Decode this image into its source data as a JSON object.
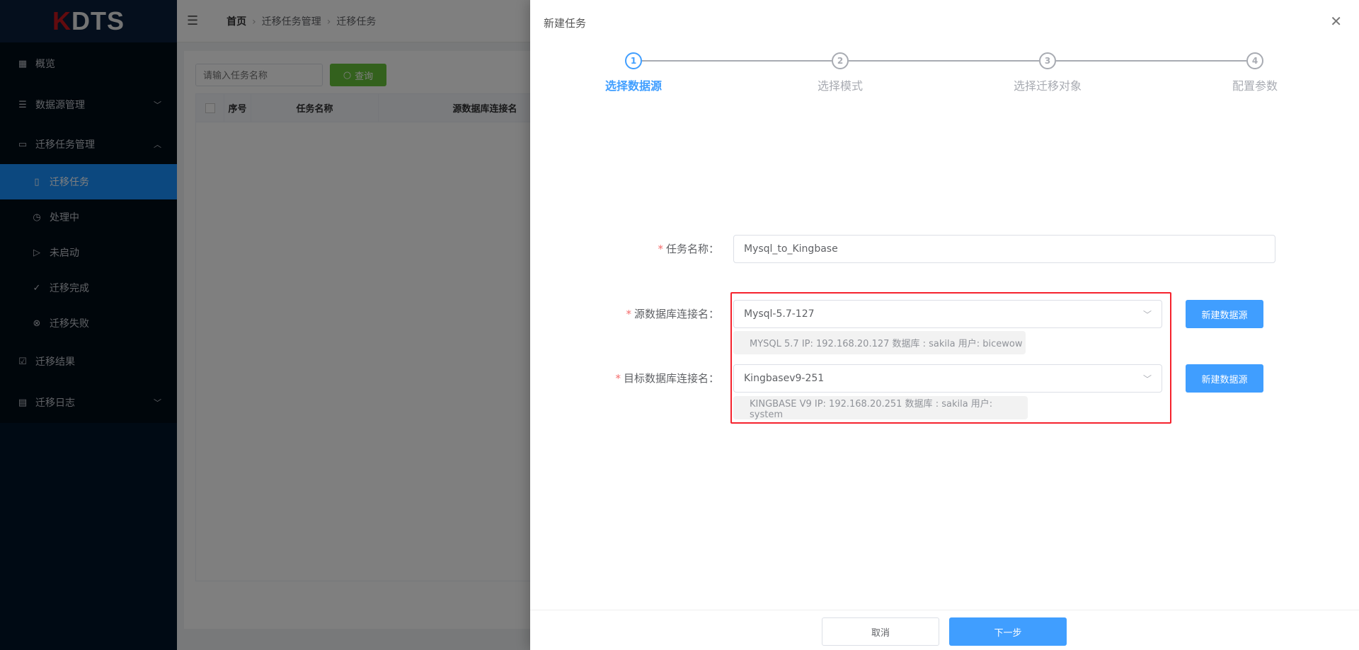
{
  "sidebar": {
    "logo": "KDTS",
    "items": [
      {
        "label": "概览",
        "icon": "grid-icon"
      },
      {
        "label": "数据源管理",
        "icon": "database-icon"
      },
      {
        "label": "迁移任务管理",
        "icon": "folder-icon"
      },
      {
        "label": "迁移任务",
        "icon": "book-icon",
        "active": true
      },
      {
        "label": "处理中",
        "icon": "stopwatch-icon"
      },
      {
        "label": "未启动",
        "icon": "play-circle-icon"
      },
      {
        "label": "迁移完成",
        "icon": "check-list-icon"
      },
      {
        "label": "迁移失败",
        "icon": "close-circle-icon"
      },
      {
        "label": "迁移结果",
        "icon": "folder-check-icon"
      },
      {
        "label": "迁移日志",
        "icon": "document-icon"
      }
    ]
  },
  "breadcrumb": [
    "首页",
    "迁移任务管理",
    "迁移任务"
  ],
  "search": {
    "placeholder": "请输入任务名称",
    "button": "查询"
  },
  "table": {
    "columns": [
      "序号",
      "任务名称",
      "源数据库连接名"
    ]
  },
  "drawer": {
    "title": "新建任务",
    "steps": [
      "选择数据源",
      "选择模式",
      "选择迁移对象",
      "配置参数"
    ],
    "active_step": 1,
    "form": {
      "task_name_label": "任务名称：",
      "task_name_value": "Mysql_to_Kingbase",
      "source_label": "源数据库连接名：",
      "source_value": "Mysql-5.7-127",
      "source_info": "MYSQL 5.7 IP: 192.168.20.127 数据库 : sakila 用户: bicewow",
      "target_label": "目标数据库连接名：",
      "target_value": "Kingbasev9-251",
      "target_info": "KINGBASE V9 IP: 192.168.20.251 数据库 : sakila 用户: system",
      "new_source_button": "新建数据源"
    },
    "cancel": "取消",
    "next": "下一步"
  },
  "colors": {
    "primary": "#409eff",
    "highlight": "#f5222d",
    "sidebar": "#001529"
  }
}
